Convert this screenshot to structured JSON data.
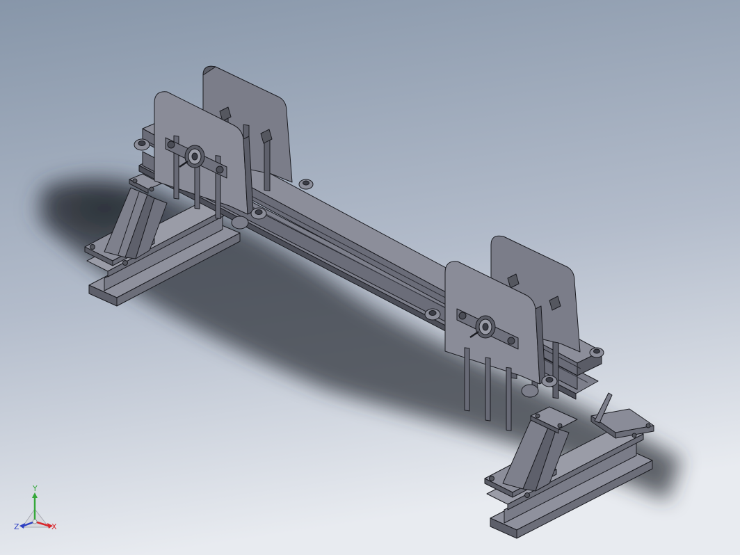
{
  "colors": {
    "bg_top": "#8a97aa",
    "bg_bottom": "#e6e9ee",
    "steel_light": "#8b8d99",
    "steel_mid": "#6f717d",
    "steel_dark": "#4c4e58",
    "edge": "#1a1b20",
    "shadow": "#2b2e36",
    "axis_x": "#d8262b",
    "axis_y": "#35a83a",
    "axis_z": "#2d3fc2"
  },
  "triad": {
    "x_label": "X",
    "y_label": "Y",
    "z_label": "Z"
  }
}
